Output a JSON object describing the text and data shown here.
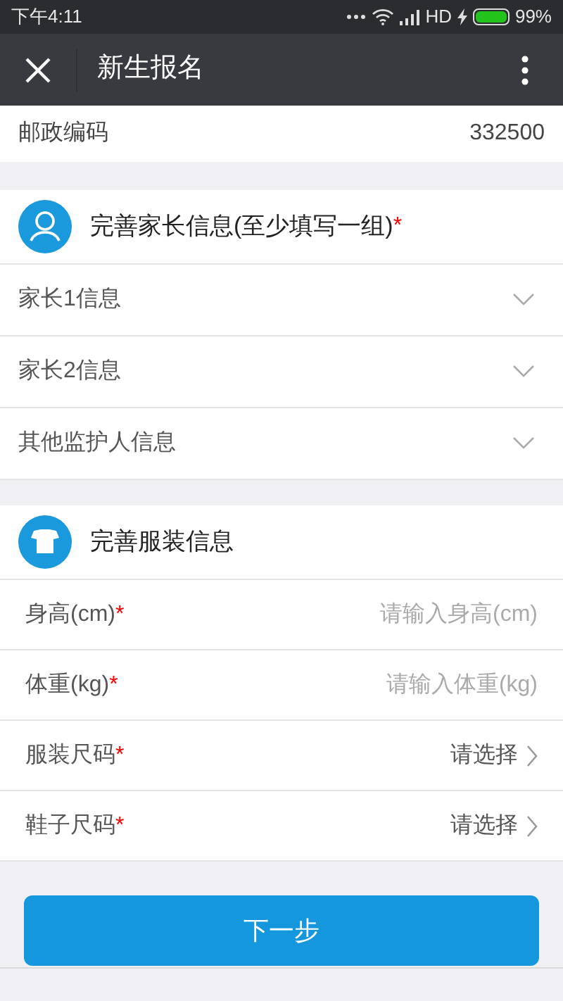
{
  "status_bar": {
    "time": "下午4:11",
    "network": "HD",
    "battery_text": "99%"
  },
  "nav_bar": {
    "title": "新生报名"
  },
  "postal_row": {
    "label": "邮政编码",
    "value": "332500"
  },
  "parent_section": {
    "title": "完善家长信息(至少填写一组)",
    "required_mark": "*",
    "items": [
      {
        "label": "家长1信息",
        "expanded": false
      },
      {
        "label": "家长2信息",
        "expanded": false
      },
      {
        "label": "其他监护人信息",
        "expanded": false
      }
    ]
  },
  "clothing_section": {
    "title": "完善服装信息",
    "fields": [
      {
        "kind": "input",
        "label": "身高(cm)",
        "required_mark": "*",
        "placeholder": "请输入身高(cm)"
      },
      {
        "kind": "input",
        "label": "体重(kg)",
        "required_mark": "*",
        "placeholder": "请输入体重(kg)"
      },
      {
        "kind": "select",
        "label": "服装尺码",
        "required_mark": "*",
        "value": "请选择"
      },
      {
        "kind": "select",
        "label": "鞋子尺码",
        "required_mark": "*",
        "value": "请选择"
      }
    ]
  },
  "next_button": "下一步"
}
